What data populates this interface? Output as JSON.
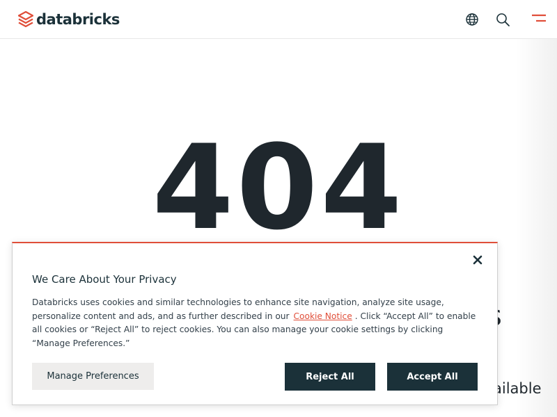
{
  "header": {
    "logo_text": "databricks",
    "icons": [
      "databricks-logo-icon",
      "globe-icon",
      "search-icon",
      "menu-icon"
    ]
  },
  "main": {
    "error_code": "404",
    "partial_text_right": "s",
    "partial_text_available": "ailable"
  },
  "cookie_banner": {
    "title": "We Care About Your Privacy",
    "body_before_link": "Databricks uses cookies and similar technologies to enhance site navigation, analyze site usage, personalize content and ads, and as further described in our",
    "link_text": "Cookie Notice",
    "body_after_link": ". Click “Accept All” to enable all cookies or “Reject All” to reject cookies. You can also manage your cookie settings by clicking “Manage Preferences.”",
    "manage_label": "Manage Preferences",
    "reject_label": "Reject All",
    "accept_label": "Accept All"
  },
  "colors": {
    "brand_red": "#e04e39",
    "dark_navy": "#1b3139",
    "text_dark": "#1f272d",
    "light_button": "#eeedec"
  }
}
